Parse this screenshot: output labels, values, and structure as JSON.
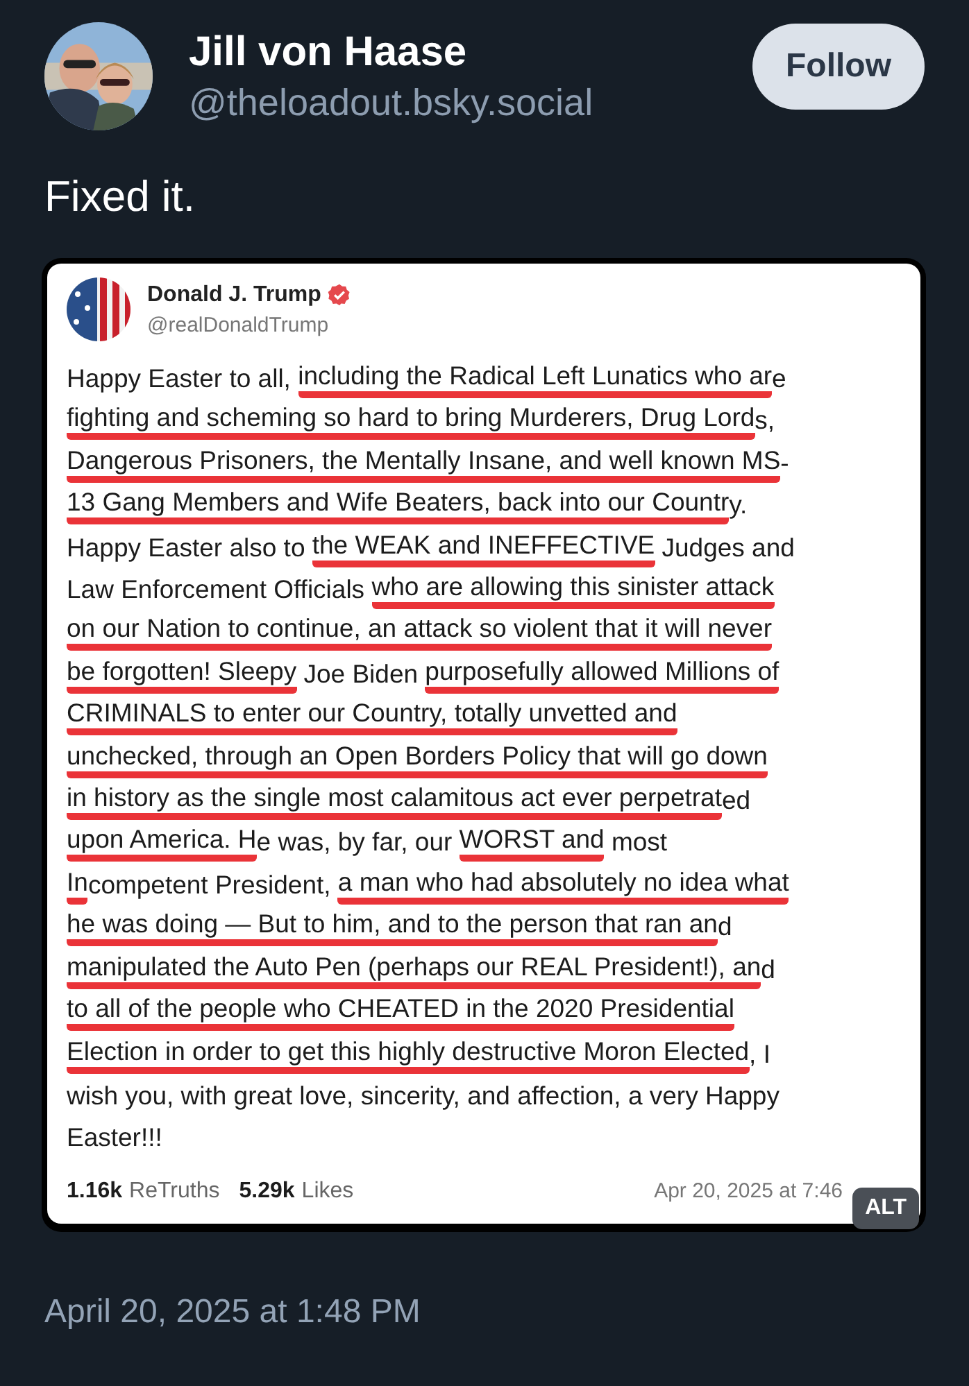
{
  "post": {
    "author": {
      "name": "Jill von Haase",
      "handle": "@theloadout.bsky.social"
    },
    "follow_button": "Follow",
    "text": "Fixed it.",
    "embed": {
      "author": {
        "name": "Donald J. Trump",
        "handle": "@realDonaldTrump",
        "verified": true
      },
      "lines": [
        [
          {
            "text": "Happy Easter to all, ",
            "struck": false
          },
          {
            "text": "including the Radical Left Lunatics who ar",
            "struck": true
          },
          {
            "text": "e",
            "struck": false
          }
        ],
        [
          {
            "text": "fighting and scheming so hard to bring Murderers, Drug Lord",
            "struck": true
          },
          {
            "text": "s,",
            "struck": false
          }
        ],
        [
          {
            "text": "Dangerous Prisoners, the Mentally Insane, and well known MS",
            "struck": true
          },
          {
            "text": "-",
            "struck": false
          }
        ],
        [
          {
            "text": "13 Gang Members and Wife Beaters, back into our Countr",
            "struck": true
          },
          {
            "text": "y.",
            "struck": false
          }
        ],
        [
          {
            "text": "Happy Easter also to ",
            "struck": false
          },
          {
            "text": "the WEAK and INEFFECTIVE",
            "struck": true
          },
          {
            "text": " Judges and",
            "struck": false
          }
        ],
        [
          {
            "text": "Law Enforcement Officials ",
            "struck": false
          },
          {
            "text": "who are allowing this sinister attack",
            "struck": true
          }
        ],
        [
          {
            "text": "on our Nation to continue, an attack so violent that it will never",
            "struck": true
          }
        ],
        [
          {
            "text": "be forgotten! Sleepy",
            "struck": true
          },
          {
            "text": " Joe Biden ",
            "struck": false
          },
          {
            "text": "purposefully allowed Millions of",
            "struck": true
          }
        ],
        [
          {
            "text": "CRIMINALS to enter our Country, totally unvetted and",
            "struck": true
          }
        ],
        [
          {
            "text": "unchecked, through an Open Borders Policy that will go down",
            "struck": true
          }
        ],
        [
          {
            "text": "in history as the single most calamitous act ever perpetrat",
            "struck": true
          },
          {
            "text": "ed",
            "struck": false
          }
        ],
        [
          {
            "text": "upon America. H",
            "struck": true
          },
          {
            "text": "e was, by far, our ",
            "struck": false
          },
          {
            "text": "WORST and",
            "struck": true
          },
          {
            "text": " most",
            "struck": false
          }
        ],
        [
          {
            "text": "In",
            "struck": true
          },
          {
            "text": "competent President, ",
            "struck": false
          },
          {
            "text": "a man who had absolutely no idea what",
            "struck": true
          }
        ],
        [
          {
            "text": "he was doing — But to him, and to the person that ran an",
            "struck": true
          },
          {
            "text": "d",
            "struck": false
          }
        ],
        [
          {
            "text": "manipulated the Auto Pen (perhaps our REAL President!), an",
            "struck": true
          },
          {
            "text": "d",
            "struck": false
          }
        ],
        [
          {
            "text": "to all of the people who CHEATED in the 2020 Presidential",
            "struck": true
          }
        ],
        [
          {
            "text": "Election in order to get this highly destructive Moron Elected",
            "struck": true
          },
          {
            "text": ", I",
            "struck": false
          }
        ],
        [
          {
            "text": "wish you, with great love, sincerity, and affection, a very Happy",
            "struck": false
          }
        ],
        [
          {
            "text": "Easter!!!",
            "struck": false
          }
        ]
      ],
      "stats": [
        {
          "count": "1.16k",
          "label": "ReTruths"
        },
        {
          "count": "5.29k",
          "label": "Likes"
        }
      ],
      "date": "Apr 20, 2025 at 7:46",
      "alt_badge": "ALT"
    },
    "timestamp": "April 20, 2025 at 1:48 PM"
  }
}
